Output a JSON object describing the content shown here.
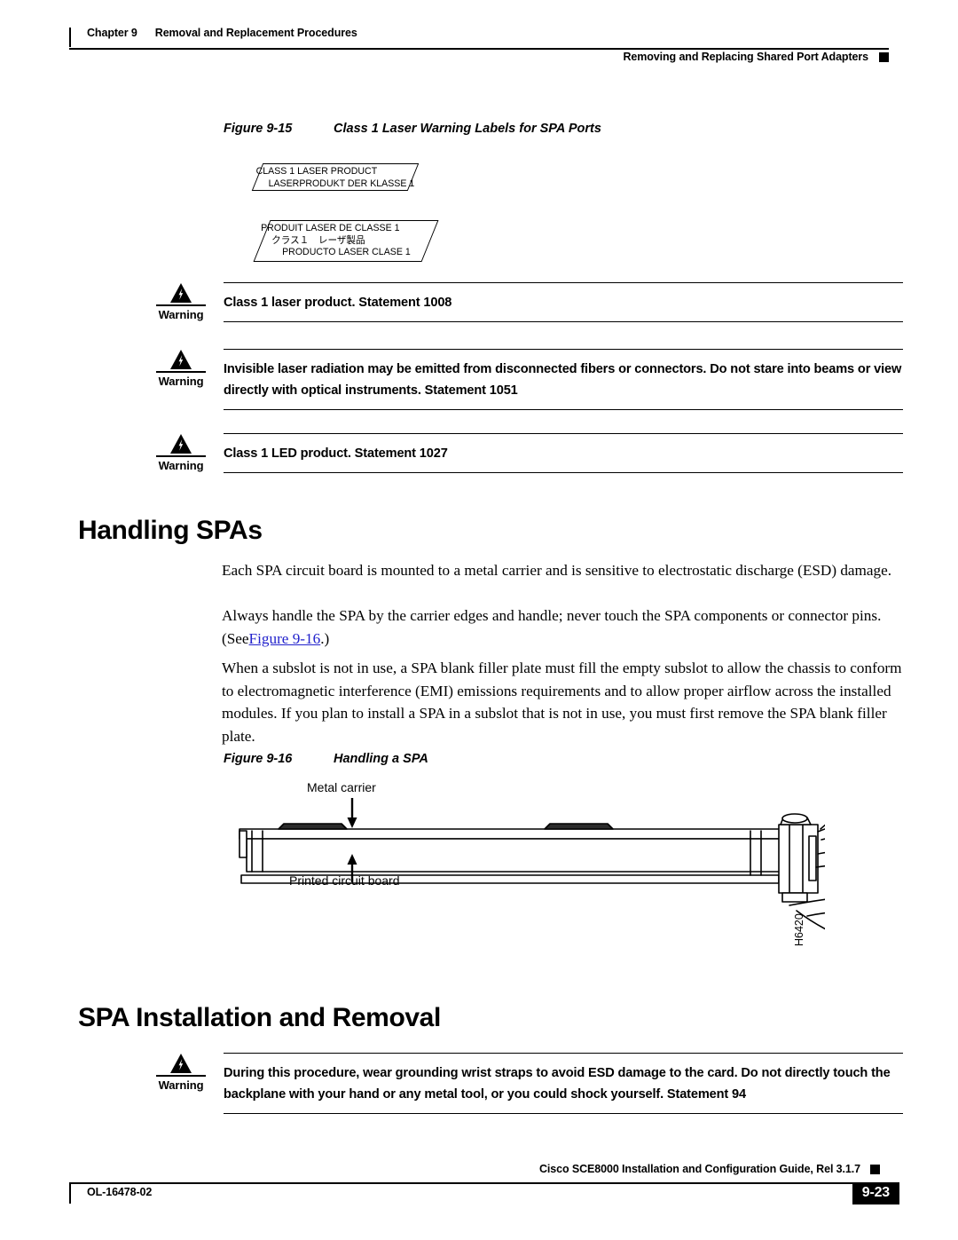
{
  "header": {
    "chapter_label": "Chapter 9",
    "chapter_title": "Removal and Replacement Procedures",
    "running_head": "Removing and Replacing Shared Port Adapters"
  },
  "figure_9_15": {
    "number": "Figure 9-15",
    "title": "Class 1 Laser Warning Labels for SPA Ports",
    "labels": [
      {
        "name": "label-class1-laser-product",
        "lines": [
          "CLASS 1 LASER PRODUCT",
          "LASERPRODUKT DER KLASSE 1"
        ]
      },
      {
        "name": "label-produit-laser-de-classe-1",
        "lines": [
          "PRODUIT LASER DE CLASSE 1",
          "クラス１　レーザ製品",
          "PRODUCTO LASER CLASE 1"
        ]
      }
    ]
  },
  "warnings": [
    {
      "label": "Warning",
      "icon": "warning-triangle-lightning-icon",
      "text": "Class 1 laser product. Statement 1008"
    },
    {
      "label": "Warning",
      "icon": "warning-triangle-lightning-icon",
      "text": "Invisible laser radiation may be emitted from disconnected fibers or connectors. Do not stare into beams or view directly with optical instruments. Statement 1051"
    },
    {
      "label": "Warning",
      "icon": "warning-triangle-lightning-icon",
      "text": "Class 1 LED product. Statement 1027"
    },
    {
      "label": "Warning",
      "icon": "warning-triangle-lightning-icon",
      "text": "During this procedure, wear grounding wrist straps to avoid ESD damage to the card. Do not directly touch the backplane with your hand or any metal tool, or you could shock yourself. Statement 94"
    }
  ],
  "sections": {
    "handling_spas": {
      "heading": "Handling SPAs",
      "paragraph_1": "Each SPA circuit board is mounted to a metal carrier and is sensitive to electrostatic discharge (ESD) damage.",
      "paragraph_2_before": "Always handle the SPA by the carrier edges and handle; never touch the SPA components or connector pins. (See",
      "paragraph_2_link": "Figure 9-16",
      "paragraph_2_after": ".)",
      "paragraph_3": "When a subslot is not in use, a SPA blank filler plate must fill the empty subslot to allow the chassis to conform to electromagnetic interference (EMI) emissions requirements and to allow proper airflow across the installed modules. If you plan to install a SPA in a subslot that is not in use, you must first remove the SPA blank filler plate."
    },
    "spa_installation": {
      "heading": "SPA Installation and Removal"
    }
  },
  "figure_9_16": {
    "number": "Figure 9-16",
    "title": "Handling a SPA",
    "callout_top": "Metal carrier",
    "callout_bottom": "Printed circuit board",
    "art_id": "H6420"
  },
  "footer": {
    "guide_title": "Cisco SCE8000 Installation and Configuration Guide, Rel 3.1.7",
    "doc_number": "OL-16478-02",
    "page_number": "9-23"
  },
  "colors": {
    "link": "#2222cc",
    "text": "#000000",
    "page_background": "#ffffff"
  }
}
